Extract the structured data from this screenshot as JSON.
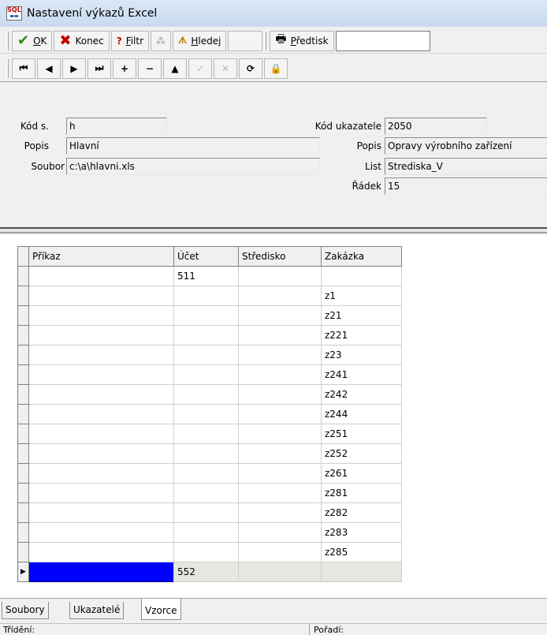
{
  "window": {
    "title": "Nastavení výkazů Excel",
    "icon": "sql-app-icon"
  },
  "toolbar1": {
    "ok_label": "OK",
    "ok_hotkey": "O",
    "ok_rest": "K",
    "konec_label": "Konec",
    "filtr_label": "Filtr",
    "filtr_hotkey": "F",
    "filtr_rest": "iltr",
    "hledej_label": "Hledej",
    "hledej_hotkey": "H",
    "hledej_rest": "ledej",
    "predtisk_label": "Předtisk",
    "predtisk_hotkey": "P",
    "predtisk_rest": "ředtisk",
    "predtisk_value": ""
  },
  "navigator": {
    "first": "⏮",
    "prior": "◀",
    "next": "▶",
    "last": "⏭",
    "insert": "+",
    "delete": "−",
    "edit": "▲",
    "post": "✓",
    "cancel": "✕",
    "refresh": "⟳",
    "lock": "🔒"
  },
  "form": {
    "kod_s_label": "Kód s.",
    "kod_s_value": "h",
    "popis_label": "Popis",
    "popis_value": "Hlavní",
    "soubor_label": "Soubor",
    "soubor_value": "c:\\a\\hlavni.xls",
    "kod_ukazatele_label": "Kód ukazatele",
    "kod_ukazatele_value": "2050",
    "popis2_label": "Popis",
    "popis2_value": "Opravy výrobního zařízení",
    "list_label": "List",
    "list_value": "Strediska_V",
    "radek_label": "Řádek",
    "radek_value": "15"
  },
  "grid": {
    "columns": [
      "Příkaz",
      "Účet",
      "Středisko",
      "Zakázka"
    ],
    "rows": [
      [
        "",
        "511",
        "",
        ""
      ],
      [
        "",
        "",
        "",
        "z1"
      ],
      [
        "",
        "",
        "",
        "z21"
      ],
      [
        "",
        "",
        "",
        "z221"
      ],
      [
        "",
        "",
        "",
        "z23"
      ],
      [
        "",
        "",
        "",
        "z241"
      ],
      [
        "",
        "",
        "",
        "z242"
      ],
      [
        "",
        "",
        "",
        "z244"
      ],
      [
        "",
        "",
        "",
        "z251"
      ],
      [
        "",
        "",
        "",
        "z252"
      ],
      [
        "",
        "",
        "",
        "z261"
      ],
      [
        "",
        "",
        "",
        "z281"
      ],
      [
        "",
        "",
        "",
        "z282"
      ],
      [
        "",
        "",
        "",
        "z283"
      ],
      [
        "",
        "",
        "",
        "z285"
      ],
      [
        "",
        "552",
        "",
        ""
      ]
    ],
    "current_row_indicator": "▶"
  },
  "tabs": [
    "Soubory",
    "Ukazatelé",
    "Vzorce"
  ],
  "status": {
    "left": "Třídění:",
    "right": "Pořadí:"
  }
}
